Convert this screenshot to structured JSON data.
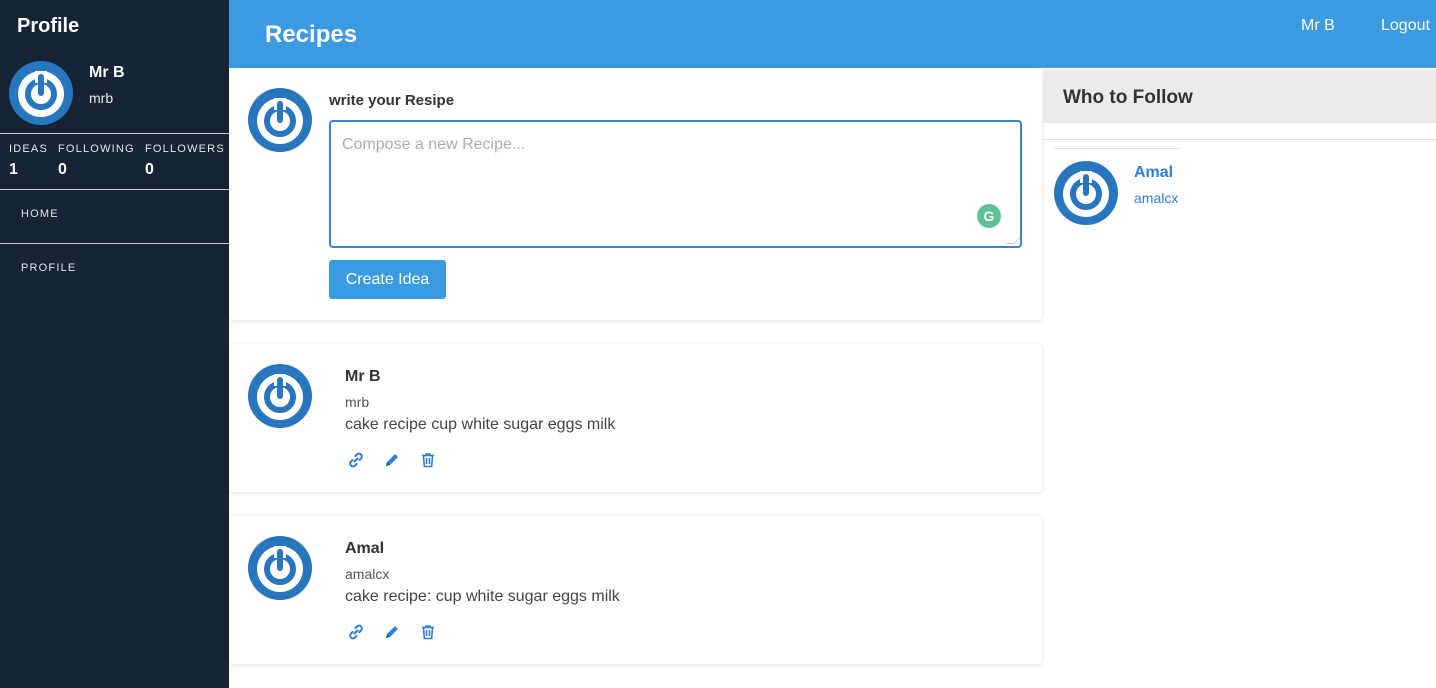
{
  "sidebar": {
    "title": "Profile",
    "user": {
      "name": "Mr B",
      "handle": "mrb"
    },
    "stats": [
      {
        "label": "IDEAS",
        "value": "1"
      },
      {
        "label": "FOLLOWING",
        "value": "0"
      },
      {
        "label": "FOLLOWERS",
        "value": "0"
      }
    ],
    "nav": [
      {
        "label": "HOME"
      },
      {
        "label": "PROFILE"
      }
    ]
  },
  "topbar": {
    "brand": "Recipes",
    "user": "Mr B",
    "logout": "Logout"
  },
  "compose": {
    "label": "write your Resipe",
    "placeholder": "Compose a new Recipe...",
    "value": "",
    "button": "Create Idea"
  },
  "posts": [
    {
      "name": "Mr B",
      "handle": "mrb",
      "body": "cake recipe cup white sugar eggs milk"
    },
    {
      "name": "Amal",
      "handle": "amalcx",
      "body": "cake recipe: cup white sugar eggs milk"
    }
  ],
  "who_to_follow": {
    "title": "Who to Follow",
    "users": [
      {
        "name": "Amal",
        "handle": "amalcx"
      }
    ]
  },
  "icons": {
    "avatar": "power-icon-avatar",
    "link": "link-icon",
    "edit": "pencil-icon",
    "delete": "trash-icon"
  },
  "colors": {
    "sidebar_bg": "#162435",
    "topbar_bg": "#3b9ae0",
    "accent": "#2f7ed8",
    "avatar_blue": "#2876be"
  }
}
